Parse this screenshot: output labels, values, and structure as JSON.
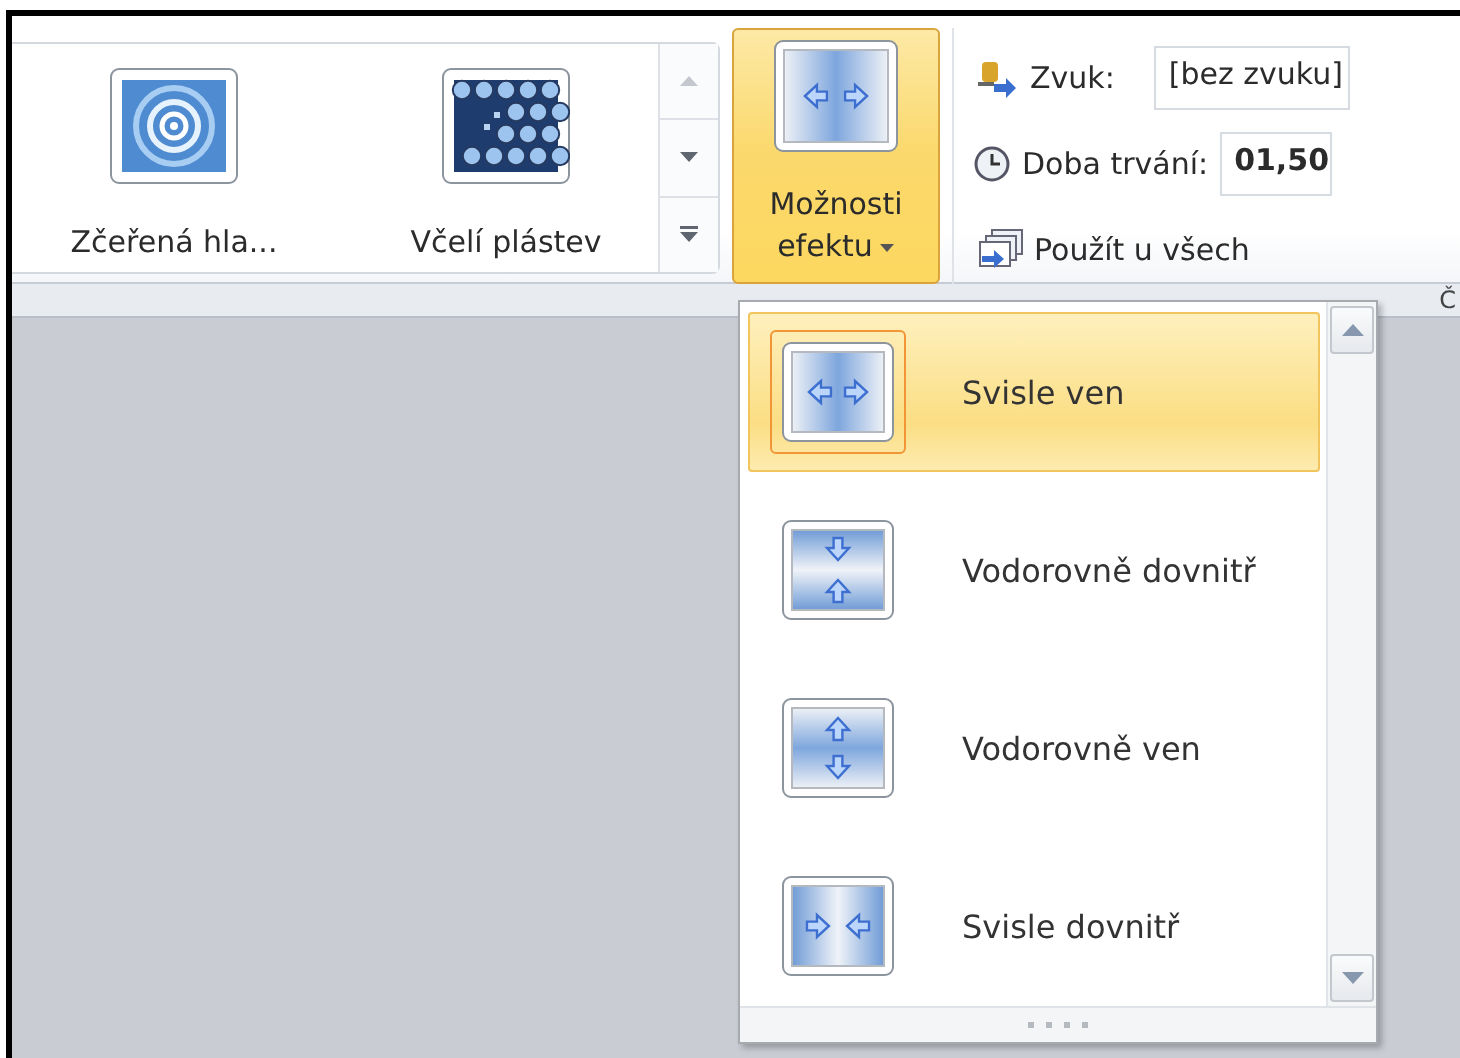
{
  "ribbon": {
    "gallery": {
      "items": [
        {
          "label": "Zčeřená hla...",
          "kind": "ripple"
        },
        {
          "label": "Včelí plástev",
          "kind": "honeycomb"
        }
      ]
    },
    "effect_options_button": {
      "label_lines": [
        "Možnosti",
        "efektu"
      ],
      "expanded": true
    },
    "sound": {
      "label": "Zvuk:",
      "value": "[bez zvuku]"
    },
    "duration": {
      "label": "Doba trvání:",
      "value": "01,50"
    },
    "apply_all": {
      "label": "Použít u všech"
    },
    "group_label": "Č"
  },
  "effect_menu": {
    "items": [
      {
        "label": "Svisle ven",
        "kind": "vertical-out",
        "selected": true
      },
      {
        "label": "Vodorovně dovnitř",
        "kind": "horizontal-in",
        "selected": false
      },
      {
        "label": "Vodorovně ven",
        "kind": "horizontal-out",
        "selected": false
      },
      {
        "label": "Svisle dovnitř",
        "kind": "vertical-in",
        "selected": false
      }
    ]
  }
}
